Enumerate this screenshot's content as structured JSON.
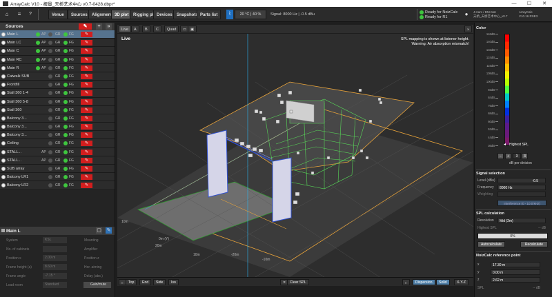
{
  "window": {
    "title": "ArrayCalc V10 - 报量_天桥艺术中心 v0.7-0428.dbpr*",
    "minimize": "—",
    "maximize": "☐",
    "close": "✕"
  },
  "toolbar": {
    "nav": [
      "Venue",
      "Sources",
      "Alignment",
      "3D plot",
      "Rigging plot",
      "Devices",
      "Snapshots",
      "Parts list"
    ],
    "active_nav": "3D plot",
    "environment": "20 °C | 40 %",
    "signal": "Signal: 8000 Hz | -0.5 dBu",
    "ready_noizcalc": "Ready for NoizCalc",
    "ready_r1": "Ready for R1",
    "user_info": "J.Ham / DM-Mar\n天桥_天桥艺术中心_v0.7",
    "version_info": "ArrayCalc\nV10.16 RSE3",
    "colors": {
      "ready": "#3ec63e",
      "accent": "#1f6fc0",
      "mute": "#d21e1e"
    }
  },
  "sources": {
    "title": "Sources",
    "items": [
      {
        "name": "Main L",
        "ap": "AP",
        "gr": "GR",
        "fg": "FG",
        "dot": "#3ec63e",
        "selected": true
      },
      {
        "name": "Main LC",
        "ap": "AP",
        "gr": "GR",
        "fg": "FG",
        "dot": "#3ec63e"
      },
      {
        "name": "Main C",
        "ap": "AP",
        "gr": "GR",
        "fg": "FG",
        "dot": "#3ec63e"
      },
      {
        "name": "Main RC",
        "ap": "AP",
        "gr": "GR",
        "fg": "FG",
        "dot": "#3ec63e"
      },
      {
        "name": "Main R",
        "ap": "AP",
        "gr": "GR",
        "fg": "FG",
        "dot": "#3ec63e"
      },
      {
        "name": "Catwalk SUB",
        "ap": "",
        "gr": "GR",
        "fg": "FG",
        "dot": ""
      },
      {
        "name": "Frontfill",
        "ap": "",
        "gr": "GR",
        "fg": "FG",
        "dot": ""
      },
      {
        "name": "Stall 360 1-4",
        "ap": "",
        "gr": "GR",
        "fg": "FG",
        "dot": ""
      },
      {
        "name": "Stall 360 5-8",
        "ap": "",
        "gr": "GR",
        "fg": "FG",
        "dot": ""
      },
      {
        "name": "Stall 360",
        "ap": "",
        "gr": "GR",
        "fg": "FG",
        "dot": ""
      },
      {
        "name": "Balcony 3...",
        "ap": "",
        "gr": "GR",
        "fg": "FG",
        "dot": ""
      },
      {
        "name": "Balcony 3...",
        "ap": "",
        "gr": "GR",
        "fg": "FG",
        "dot": ""
      },
      {
        "name": "Balcony 3...",
        "ap": "",
        "gr": "GR",
        "fg": "FG",
        "dot": ""
      },
      {
        "name": "Ceiling",
        "ap": "",
        "gr": "GR",
        "fg": "FG",
        "dot": ""
      },
      {
        "name": "STALL...",
        "ap": "AP",
        "gr": "GR",
        "fg": "FG",
        "dot": ""
      },
      {
        "name": "STALL...",
        "ap": "AP",
        "gr": "GR",
        "fg": "FG",
        "dot": ""
      },
      {
        "name": "SUB array",
        "ap": "",
        "gr": "GR",
        "fg": "FG",
        "dot": ""
      },
      {
        "name": "Balcony LR1",
        "ap": "",
        "gr": "GR",
        "fg": "FG",
        "dot": ""
      },
      {
        "name": "Balcony LR2",
        "ap": "",
        "gr": "GR",
        "fg": "FG",
        "dot": ""
      }
    ]
  },
  "main_l": {
    "title": "Main L",
    "rows": [
      {
        "label": "System",
        "value": "KSL",
        "label2": "Mounting",
        "value2": ""
      },
      {
        "label": "No. of cabinets",
        "value": "",
        "label2": "Amplifier",
        "value2": ""
      },
      {
        "label": "Position x",
        "value": "2.00 m",
        "label2": "Position z",
        "value2": ""
      },
      {
        "label": "Frame height (a)",
        "value": "8.60 m",
        "label2": "Hor. aiming",
        "value2": ""
      },
      {
        "label": "Frame angle",
        "value": "-7.15 °",
        "label2": "Delay (abs.)",
        "value2": ""
      },
      {
        "label": "Load room",
        "value": "Standard",
        "label2": "",
        "value2": "Gain/mute"
      }
    ]
  },
  "view": {
    "tabs": [
      "Live",
      "A",
      "B",
      "C",
      "Quad"
    ],
    "live_label": "Live",
    "spl_note_1": "SPL mapping is shown at listener height.",
    "spl_note_2": "Warning: Air absorption mismatch!",
    "grid_labels": [
      "10m",
      "0m (Y)",
      "10m",
      "-20m",
      "20m",
      "-10m"
    ],
    "bottom_left": [
      "Top",
      "End",
      "Side",
      "Iso"
    ],
    "clear_spl": "Clear SPL",
    "bottom_right": [
      "Dispersion",
      "Solid",
      "X-Y-Z"
    ]
  },
  "color_panel": {
    "title": "Color",
    "scale_labels": [
      "146dB",
      "140dB",
      "132dB",
      "124dB",
      "116dB",
      "108dB",
      "100dB",
      "92dB",
      "84dB",
      "76dB",
      "68dB",
      "60dB",
      "52dB",
      "44dB",
      "36dB"
    ],
    "highest_spl": "Highest SPL",
    "db_per_div_value": "3",
    "db_per_div_label": "dB per division",
    "colors": [
      "#ff0000",
      "#ff2a00",
      "#ff5a00",
      "#ff8c00",
      "#ffbf00",
      "#f0f000",
      "#b8ff00",
      "#50ff40",
      "#00c8c8",
      "#0080ff",
      "#0030e0",
      "#3c1fa0",
      "#5a1a8a",
      "#6a1a7a",
      "#7a1a6a"
    ]
  },
  "signal_selection": {
    "title": "Signal selection",
    "level_label": "Level (dBu)",
    "level_value": "-0.5",
    "frequency_label": "Frequency",
    "frequency_value": "8000 Hz",
    "weighting_label": "Weighting",
    "weighting_value": "",
    "interference_btn": "Interference (0 - 10.0 kHz)"
  },
  "spl_calc": {
    "title": "SPL calculation",
    "resolution_label": "Resolution",
    "resolution_value": "Mid (2m)",
    "highest_spl_label": "Highest SPL",
    "highest_spl_value": "-- dB",
    "progress_text": "0%",
    "progress": 0,
    "autocalc": "Autocalculate",
    "recalc": "Recalculate"
  },
  "noizcalc": {
    "title": "NoizCalc reference point",
    "x_label": "x",
    "x_value": "17.30 m",
    "y_label": "y",
    "y_value": "0.00 m",
    "z_label": "z",
    "z_value": "2.62 m",
    "spl_label": "SPL",
    "spl_value": "-- dB"
  }
}
